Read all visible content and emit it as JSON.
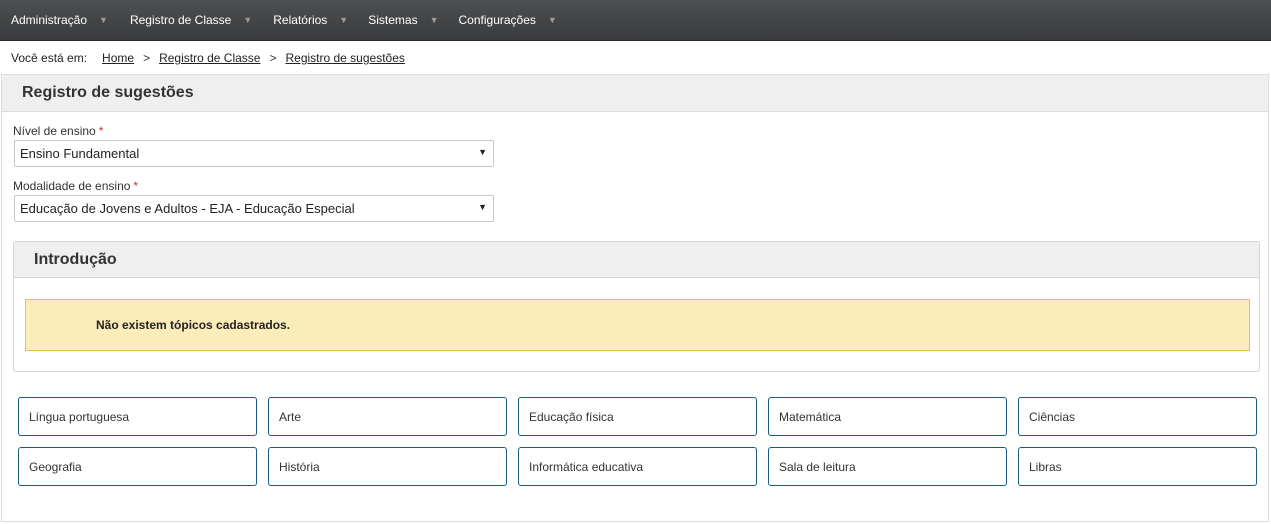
{
  "nav": {
    "items": [
      {
        "label": "Administração"
      },
      {
        "label": "Registro de Classe"
      },
      {
        "label": "Relatórios"
      },
      {
        "label": "Sistemas"
      },
      {
        "label": "Configurações"
      }
    ],
    "arrow": "▼"
  },
  "breadcrumb": {
    "prefix": "Você está em:",
    "sep": ">",
    "links": [
      "Home",
      "Registro de Classe",
      "Registro de sugestões"
    ]
  },
  "page": {
    "title": "Registro de sugestões"
  },
  "form": {
    "required_mark": "*",
    "nivel": {
      "label": "Nível de ensino",
      "value": "Ensino Fundamental"
    },
    "modalidade": {
      "label": "Modalidade de ensino",
      "value": "Educação de Jovens e Adultos - EJA - Educação Especial"
    },
    "caret": "▼"
  },
  "intro": {
    "title": "Introdução",
    "message": "Não existem tópicos cadastrados."
  },
  "subjects": [
    "Língua portuguesa",
    "Arte",
    "Educação física",
    "Matemática",
    "Ciências",
    "Geografia",
    "História",
    "Informática educativa",
    "Sala de leitura",
    "Libras"
  ],
  "colors": {
    "nav_bg": "#414345",
    "alert_bg": "#fbecb9",
    "alert_border": "#e8c05a",
    "subject_border": "#1b5a82",
    "required": "#c0392b"
  }
}
